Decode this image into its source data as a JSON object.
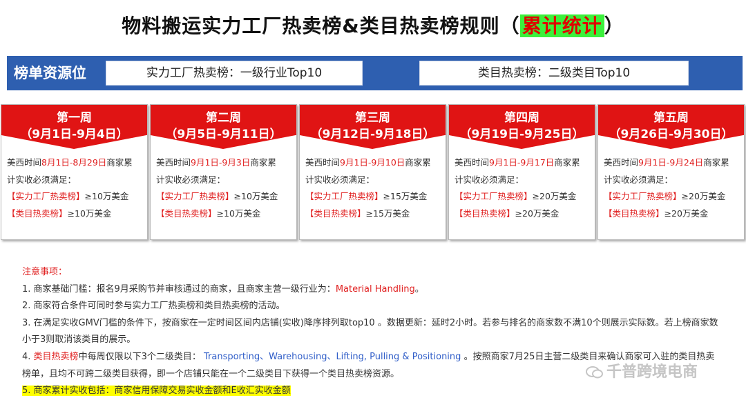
{
  "title": {
    "main": "物料搬运实力工厂热卖榜&类目热卖榜规则（",
    "highlight": "累计统计",
    "close": "）"
  },
  "source": {
    "label": "榜单资源位",
    "box1": "实力工厂热卖榜：一级行业Top10",
    "box2": "类目热卖榜：二级类目Top10"
  },
  "weeks": [
    {
      "name": "第一周",
      "dates": "（9月1日-9月4日）",
      "line1_pre": "美西时间",
      "range": "8月1日-8月29日",
      "line1_post": "商家累",
      "line2": "计实收必须满足：",
      "r1_tag": "【实力工厂热卖榜】",
      "r1_val": "≥10万美金",
      "r2_tag": "【类目热卖榜】",
      "r2_val": "≥10万美金"
    },
    {
      "name": "第二周",
      "dates": "（9月5日-9月11日）",
      "line1_pre": "美西时间",
      "range": "9月1日-9月3日",
      "line1_post": "商家累",
      "line2": "计实收必须满足：",
      "r1_tag": "【实力工厂热卖榜】",
      "r1_val": "≥10万美金",
      "r2_tag": "【类目热卖榜】",
      "r2_val": "≥10万美金"
    },
    {
      "name": "第三周",
      "dates": "（9月12日-9月18日）",
      "line1_pre": "美西时间",
      "range": "9月1日-9月10日",
      "line1_post": "商家累",
      "line2": "计实收必须满足：",
      "r1_tag": "【实力工厂热卖榜】",
      "r1_val": "≥15万美金",
      "r2_tag": "【类目热卖榜】",
      "r2_val": "≥15万美金"
    },
    {
      "name": "第四周",
      "dates": "（9月19日-9月25日）",
      "line1_pre": "美西时间",
      "range": "9月1日-9月17日",
      "line1_post": "商家累",
      "line2": "计实收必须满足：",
      "r1_tag": "【实力工厂热卖榜】",
      "r1_val": "≥20万美金",
      "r2_tag": "【类目热卖榜】",
      "r2_val": "≥20万美金"
    },
    {
      "name": "第五周",
      "dates": "（9月26日-9月30日）",
      "line1_pre": "美西时间",
      "range": "9月1日-9月24日",
      "line1_post": "商家累",
      "line2": "计实收必须满足：",
      "r1_tag": "【实力工厂热卖榜】",
      "r1_val": "≥20万美金",
      "r2_tag": "【类目热卖榜】",
      "r2_val": "≥20万美金"
    }
  ],
  "notes": {
    "title": "注意事项：",
    "n1_pre": "1. 商家基础门槛：报名9月采购节并审核通过的商家，且商家主营一级行业为：",
    "n1_en": "Material Handling",
    "n1_post": "。",
    "n2": "2. 商家符合条件可同时参与实力工厂热卖榜和类目热卖榜的活动。",
    "n3a": "3. 在满足实收GMV门槛的条件下，按商家在一定时间区间内店铺(实收)降序排列取top10 。数据更新：延时2小时。若参与排名的商家数不满10个则展示实际数。若上榜商家数",
    "n3b": "小于3则取消该类目的展示。",
    "n4_pre": "4. ",
    "n4_tag": "类目热卖榜",
    "n4_mid": "中每周仅限以下3个二级类目：",
    "n4_cats": "Transporting、Warehousing、Lifting, Pulling & Positioning",
    "n4_post": "。按照商家7月25日主营二级类目来确认商家可入驻的类目热卖",
    "n4b": "榜单，且均不可跨二级类目获得，即一个店铺只能在一个二级类目下获得一个类目热卖榜资源。",
    "n5": "5. 商家累计实收包括：商家信用保障交易实收金额和E收汇实收金额"
  },
  "watermark": "千普跨境电商"
}
